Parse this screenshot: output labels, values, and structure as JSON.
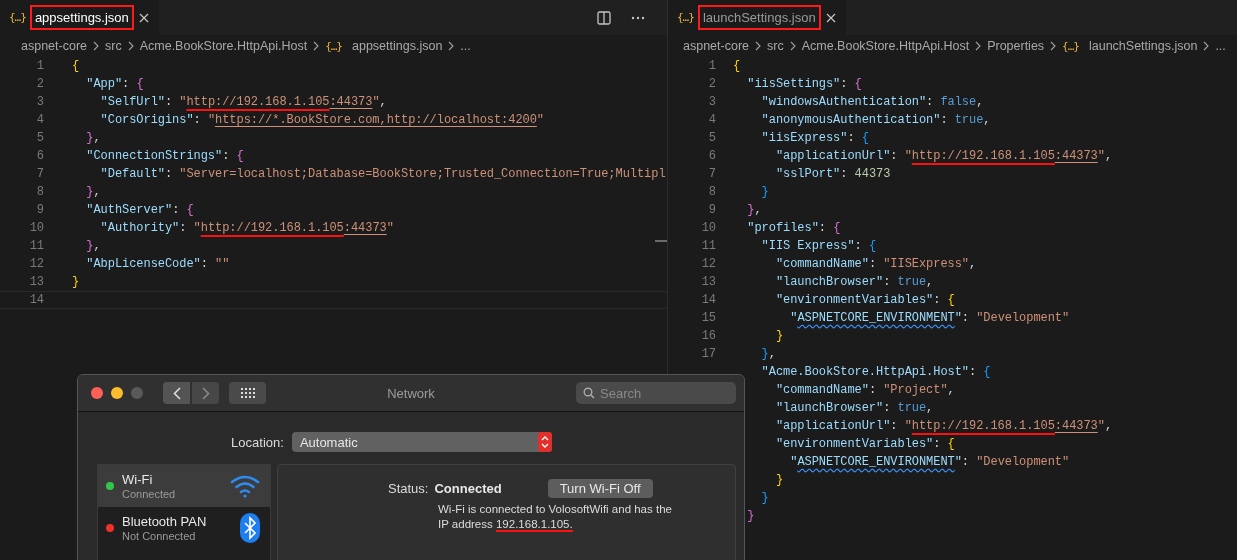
{
  "editors": [
    {
      "tab": {
        "icon": "{…}",
        "label": "appsettings.json",
        "focused": true,
        "highlighted": true
      },
      "show_actions": true,
      "breadcrumb": [
        {
          "label": "aspnet-core",
          "kind": "folder"
        },
        {
          "label": "src",
          "kind": "folder"
        },
        {
          "label": "Acme.BookStore.HttpApi.Host",
          "kind": "folder"
        },
        {
          "icon": "{…}",
          "label": "appsettings.json",
          "kind": "file"
        },
        {
          "label": "...",
          "kind": "more"
        }
      ],
      "lines": [
        {
          "number": "1",
          "current": false,
          "tokens": [
            {
              "text": "{",
              "kind": "b1"
            }
          ]
        },
        {
          "number": "2",
          "current": false,
          "tokens": [
            {
              "text": "  \"App\"",
              "kind": "key"
            },
            {
              "text": ": ",
              "kind": "p"
            },
            {
              "text": "{",
              "kind": "b2"
            }
          ]
        },
        {
          "number": "3",
          "current": false,
          "tokens": [
            {
              "text": "    \"SelfUrl\"",
              "kind": "key"
            },
            {
              "text": ": ",
              "kind": "p"
            },
            {
              "text": "\"",
              "kind": "str"
            },
            {
              "text": "http://192.168.1.105",
              "kind": "link-marked"
            },
            {
              "text": ":44373",
              "kind": "link"
            },
            {
              "text": "\"",
              "kind": "str"
            },
            {
              "text": ",",
              "kind": "p"
            }
          ]
        },
        {
          "number": "4",
          "current": false,
          "tokens": [
            {
              "text": "    \"CorsOrigins\"",
              "kind": "key"
            },
            {
              "text": ": ",
              "kind": "p"
            },
            {
              "text": "\"",
              "kind": "str"
            },
            {
              "text": "https://*.BookStore.com,http://localhost:4200",
              "kind": "link"
            },
            {
              "text": "\"",
              "kind": "str"
            }
          ]
        },
        {
          "number": "5",
          "current": false,
          "tokens": [
            {
              "text": "  }",
              "kind": "b2"
            },
            {
              "text": ",",
              "kind": "p"
            }
          ]
        },
        {
          "number": "6",
          "current": false,
          "tokens": [
            {
              "text": "  \"ConnectionStrings\"",
              "kind": "key"
            },
            {
              "text": ": ",
              "kind": "p"
            },
            {
              "text": "{",
              "kind": "b2"
            }
          ]
        },
        {
          "number": "7",
          "current": false,
          "tokens": [
            {
              "text": "    \"Default\"",
              "kind": "key"
            },
            {
              "text": ": ",
              "kind": "p"
            },
            {
              "text": "\"Server=localhost;Database=BookStore;Trusted_Connection=True;Multipl",
              "kind": "str"
            }
          ]
        },
        {
          "number": "8",
          "current": false,
          "tokens": [
            {
              "text": "  }",
              "kind": "b2"
            },
            {
              "text": ",",
              "kind": "p"
            }
          ]
        },
        {
          "number": "9",
          "current": false,
          "tokens": [
            {
              "text": "  \"AuthServer\"",
              "kind": "key"
            },
            {
              "text": ": ",
              "kind": "p"
            },
            {
              "text": "{",
              "kind": "b2"
            }
          ]
        },
        {
          "number": "10",
          "current": false,
          "tokens": [
            {
              "text": "    \"Authority\"",
              "kind": "key"
            },
            {
              "text": ": ",
              "kind": "p"
            },
            {
              "text": "\"",
              "kind": "str"
            },
            {
              "text": "http://192.168.1.105",
              "kind": "link-marked"
            },
            {
              "text": ":44373",
              "kind": "link"
            },
            {
              "text": "\"",
              "kind": "str"
            }
          ]
        },
        {
          "number": "11",
          "current": false,
          "tokens": [
            {
              "text": "  }",
              "kind": "b2"
            },
            {
              "text": ",",
              "kind": "p"
            }
          ]
        },
        {
          "number": "12",
          "current": false,
          "tokens": [
            {
              "text": "  \"AbpLicenseCode\"",
              "kind": "key"
            },
            {
              "text": ": ",
              "kind": "p"
            },
            {
              "text": "\"\"",
              "kind": "str"
            }
          ]
        },
        {
          "number": "13",
          "current": false,
          "tokens": [
            {
              "text": "}",
              "kind": "b1"
            }
          ]
        },
        {
          "number": "14",
          "current": true
        }
      ]
    },
    {
      "tab": {
        "icon": "{…}",
        "label": "launchSettings.json",
        "focused": false,
        "highlighted": true
      },
      "show_actions": false,
      "breadcrumb": [
        {
          "label": "aspnet-core",
          "kind": "folder"
        },
        {
          "label": "src",
          "kind": "folder"
        },
        {
          "label": "Acme.BookStore.HttpApi.Host",
          "kind": "folder"
        },
        {
          "label": "Properties",
          "kind": "folder"
        },
        {
          "icon": "{…}",
          "label": "launchSettings.json",
          "kind": "file"
        },
        {
          "label": "...",
          "kind": "more"
        }
      ],
      "lines": [
        {
          "number": "1",
          "current": false,
          "tokens": [
            {
              "text": "{",
              "kind": "b1"
            }
          ]
        },
        {
          "number": "2",
          "current": false,
          "tokens": [
            {
              "text": "  \"iisSettings\"",
              "kind": "key"
            },
            {
              "text": ": ",
              "kind": "p"
            },
            {
              "text": "{",
              "kind": "b2"
            }
          ]
        },
        {
          "number": "3",
          "current": false,
          "tokens": [
            {
              "text": "    \"windowsAuthentication\"",
              "kind": "key"
            },
            {
              "text": ": ",
              "kind": "p"
            },
            {
              "text": "false",
              "kind": "kw"
            },
            {
              "text": ",",
              "kind": "p"
            }
          ]
        },
        {
          "number": "4",
          "current": false,
          "tokens": [
            {
              "text": "    \"anonymousAuthentication\"",
              "kind": "key"
            },
            {
              "text": ": ",
              "kind": "p"
            },
            {
              "text": "true",
              "kind": "kw"
            },
            {
              "text": ",",
              "kind": "p"
            }
          ]
        },
        {
          "number": "5",
          "current": false,
          "tokens": [
            {
              "text": "    \"iisExpress\"",
              "kind": "key"
            },
            {
              "text": ": ",
              "kind": "p"
            },
            {
              "text": "{",
              "kind": "b3"
            }
          ]
        },
        {
          "number": "6",
          "current": false,
          "tokens": [
            {
              "text": "      \"applicationUrl\"",
              "kind": "key"
            },
            {
              "text": ": ",
              "kind": "p"
            },
            {
              "text": "\"",
              "kind": "str"
            },
            {
              "text": "http://192.168.1.105",
              "kind": "link-marked"
            },
            {
              "text": ":44373",
              "kind": "link"
            },
            {
              "text": "\"",
              "kind": "str"
            },
            {
              "text": ",",
              "kind": "p"
            }
          ]
        },
        {
          "number": "7",
          "current": false,
          "tokens": [
            {
              "text": "      \"sslPort\"",
              "kind": "key"
            },
            {
              "text": ": ",
              "kind": "p"
            },
            {
              "text": "44373",
              "kind": "num"
            }
          ]
        },
        {
          "number": "8",
          "current": false,
          "tokens": [
            {
              "text": "    }",
              "kind": "b3"
            }
          ]
        },
        {
          "number": "9",
          "current": false,
          "tokens": [
            {
              "text": "  }",
              "kind": "b2"
            },
            {
              "text": ",",
              "kind": "p"
            }
          ]
        },
        {
          "number": "10",
          "current": false,
          "tokens": [
            {
              "text": "  \"profiles\"",
              "kind": "key"
            },
            {
              "text": ": ",
              "kind": "p"
            },
            {
              "text": "{",
              "kind": "b2"
            }
          ]
        },
        {
          "number": "11",
          "current": false,
          "tokens": [
            {
              "text": "    \"IIS Express\"",
              "kind": "key"
            },
            {
              "text": ": ",
              "kind": "p"
            },
            {
              "text": "{",
              "kind": "b3"
            }
          ]
        },
        {
          "number": "12",
          "current": false,
          "tokens": [
            {
              "text": "      \"commandName\"",
              "kind": "key"
            },
            {
              "text": ": ",
              "kind": "p"
            },
            {
              "text": "\"IISExpress\"",
              "kind": "str"
            },
            {
              "text": ",",
              "kind": "p"
            }
          ]
        },
        {
          "number": "13",
          "current": false,
          "tokens": [
            {
              "text": "      \"launchBrowser\"",
              "kind": "key"
            },
            {
              "text": ": ",
              "kind": "p"
            },
            {
              "text": "true",
              "kind": "kw"
            },
            {
              "text": ",",
              "kind": "p"
            }
          ]
        },
        {
          "number": "14",
          "current": false,
          "tokens": [
            {
              "text": "      \"environmentVariables\"",
              "kind": "key"
            },
            {
              "text": ": ",
              "kind": "p"
            },
            {
              "text": "{",
              "kind": "b1"
            }
          ]
        },
        {
          "number": "15",
          "current": false,
          "tokens": [
            {
              "text": "        \"",
              "kind": "key"
            },
            {
              "text": "ASPNETCORE_ENVIRONMENT",
              "kind": "warn"
            },
            {
              "text": "\"",
              "kind": "key"
            },
            {
              "text": ": ",
              "kind": "p"
            },
            {
              "text": "\"Development\"",
              "kind": "str"
            }
          ]
        },
        {
          "number": "16",
          "current": false,
          "tokens": [
            {
              "text": "      }",
              "kind": "b1"
            }
          ]
        },
        {
          "number": "17",
          "current": false,
          "tokens": [
            {
              "text": "    }",
              "kind": "b3"
            },
            {
              "text": ",",
              "kind": "p"
            }
          ]
        },
        {
          "current": false,
          "tokens": [
            {
              "text": "    \"Acme.BookStore.HttpApi.Host\"",
              "kind": "key"
            },
            {
              "text": ": ",
              "kind": "p"
            },
            {
              "text": "{",
              "kind": "b3"
            }
          ]
        },
        {
          "current": false,
          "tokens": [
            {
              "text": "      \"commandName\"",
              "kind": "key"
            },
            {
              "text": ": ",
              "kind": "p"
            },
            {
              "text": "\"Project\"",
              "kind": "str"
            },
            {
              "text": ",",
              "kind": "p"
            }
          ]
        },
        {
          "current": false,
          "tokens": [
            {
              "text": "      \"launchBrowser\"",
              "kind": "key"
            },
            {
              "text": ": ",
              "kind": "p"
            },
            {
              "text": "true",
              "kind": "kw"
            },
            {
              "text": ",",
              "kind": "p"
            }
          ]
        },
        {
          "current": false,
          "tokens": [
            {
              "text": "      \"applicationUrl\"",
              "kind": "key"
            },
            {
              "text": ": ",
              "kind": "p"
            },
            {
              "text": "\"",
              "kind": "str"
            },
            {
              "text": "http://192.168.1.105",
              "kind": "link-marked"
            },
            {
              "text": ":44373",
              "kind": "link"
            },
            {
              "text": "\"",
              "kind": "str"
            },
            {
              "text": ",",
              "kind": "p"
            }
          ]
        },
        {
          "current": false,
          "tokens": [
            {
              "text": "      \"environmentVariables\"",
              "kind": "key"
            },
            {
              "text": ": ",
              "kind": "p"
            },
            {
              "text": "{",
              "kind": "b1"
            }
          ]
        },
        {
          "current": false,
          "tokens": [
            {
              "text": "        \"",
              "kind": "key"
            },
            {
              "text": "ASPNETCORE_ENVIRONMENT",
              "kind": "warn"
            },
            {
              "text": "\"",
              "kind": "key"
            },
            {
              "text": ": ",
              "kind": "p"
            },
            {
              "text": "\"Development\"",
              "kind": "str"
            }
          ]
        },
        {
          "current": false,
          "tokens": [
            {
              "text": "      }",
              "kind": "b1"
            }
          ]
        },
        {
          "current": false,
          "tokens": [
            {
              "text": "    }",
              "kind": "b3"
            }
          ]
        },
        {
          "current": false,
          "tokens": [
            {
              "text": "  }",
              "kind": "b2"
            }
          ]
        }
      ]
    }
  ],
  "network_window": {
    "title": "Network",
    "search": {
      "placeholder": "Search"
    },
    "location": {
      "label": "Location:",
      "value": "Automatic"
    },
    "services": [
      {
        "name": "Wi-Fi",
        "status": "Connected",
        "color": "#32c848",
        "selected": true,
        "kind": "wifi"
      },
      {
        "name": "Bluetooth PAN",
        "status": "Not Connected",
        "color": "#f0302c",
        "selected": false,
        "kind": "bluetooth"
      }
    ],
    "status": {
      "label": "Status:",
      "value": "Connected",
      "button": "Turn Wi-Fi Off",
      "description": "Wi-Fi is connected to VolosoftWifi and has the",
      "address_line": "IP address",
      "address": "192.168.1.105.",
      "address_marked": true
    }
  }
}
